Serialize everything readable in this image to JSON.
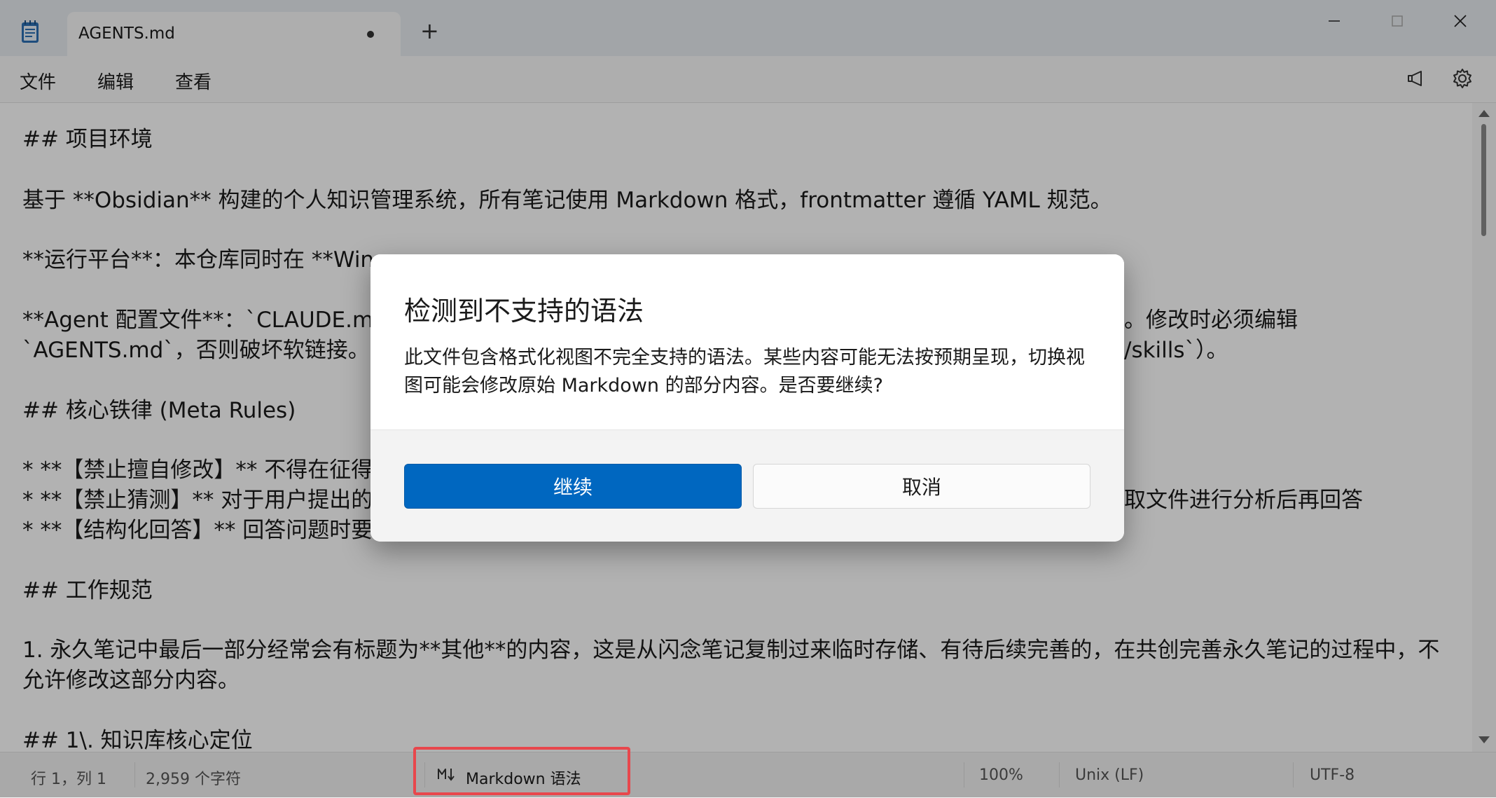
{
  "window": {
    "tab_title": "AGENTS.md",
    "new_tab_label": "+"
  },
  "menu": {
    "file": "文件",
    "edit": "编辑",
    "view": "查看"
  },
  "editor": {
    "lines": [
      "## 项目环境",
      "基于 **Obsidian** 构建的个人知识管理系统，所有笔记使用 Markdown 格式，frontmatter 遵循 YAML 规范。",
      "**运行平台**：本仓库同时在 **Win",
      "**Agent 配置文件**：`CLAUDE.md",
      "`AGENTS.md`，否则破坏软链接。s",
      "## 核心铁律 (Meta Rules)",
      "* **【禁止擅自修改】** 不得在征得",
      "* **【禁止猜测】** 对于用户提出的",
      "* **【结构化回答】** 回答问题时要",
      "## 工作规范",
      "1. 永久笔记中最后一部分经常会有标题为**其他**的内容，这是从闪念笔记复制过来临时存储、有待后续完善的，在共创完善永久笔记的过程中，不",
      "允许修改这部分内容。",
      "## 1\\. 知识库核心定位"
    ],
    "right_fragments": [
      "。修改时必须编辑",
      "/skills`）。",
      "取文件进行分析后再回答"
    ]
  },
  "dialog": {
    "title": "检测到不支持的语法",
    "message": "此文件包含格式化视图不完全支持的语法。某些内容可能无法按预期呈现，切换视图可能会修改原始 Markdown 的部分内容。是否要继续?",
    "continue_label": "继续",
    "cancel_label": "取消",
    "primary_color": "#0067c0"
  },
  "status": {
    "position": "行 1，列 1",
    "char_count": "2,959 个字符",
    "syntax_mode": "Markdown 语法",
    "zoom": "100%",
    "line_ending": "Unix (LF)",
    "encoding": "UTF-8",
    "highlight_color": "#e8474c"
  }
}
